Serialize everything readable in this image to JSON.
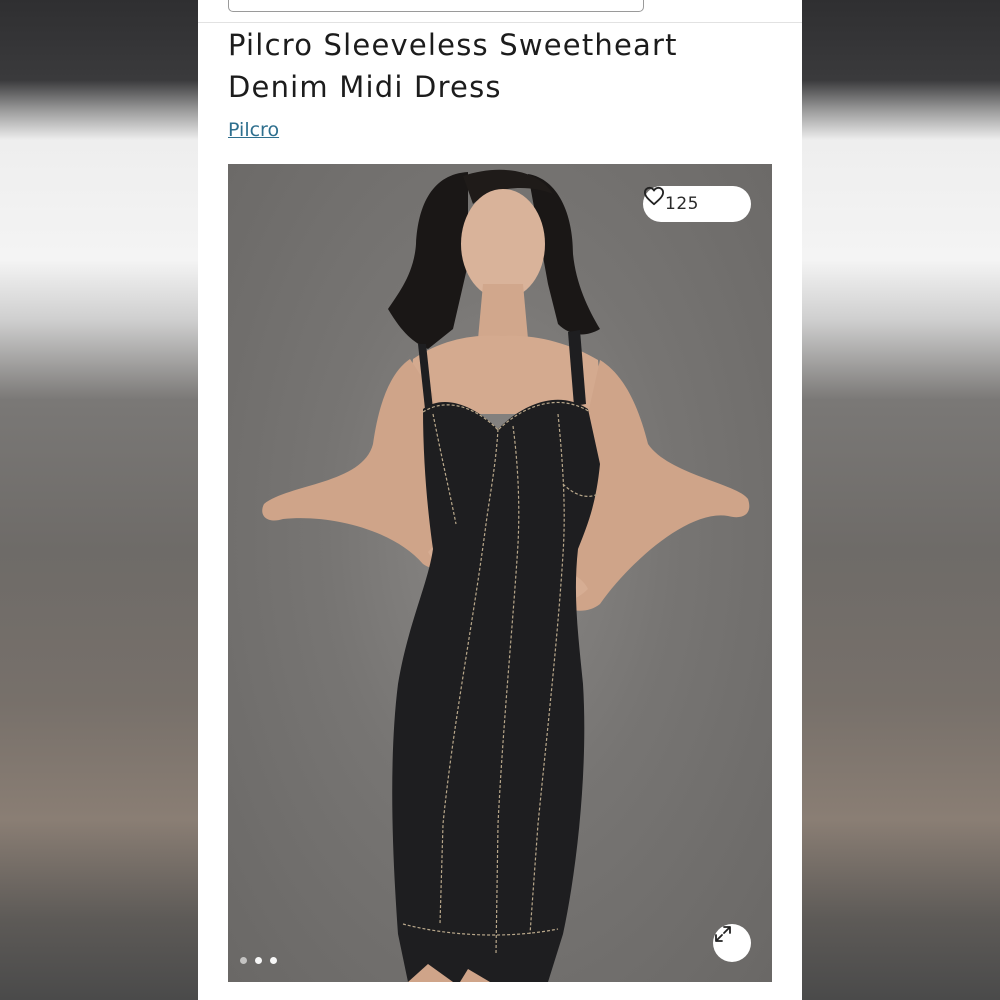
{
  "product": {
    "title_line1": "Pilcro Sleeveless Sweetheart",
    "title_line2": "Denim Midi Dress",
    "brand": "Pilcro"
  },
  "gallery": {
    "like_count": "125",
    "active_slide": 1,
    "slide_count": 3
  },
  "icons": {
    "like": "heart-outline-icon",
    "expand": "expand-arrows-icon"
  },
  "colors": {
    "brand_link": "#2e6f8e",
    "title_text": "#1c1c1c",
    "dress": "#1e1e20",
    "background_photo": "#777573"
  }
}
